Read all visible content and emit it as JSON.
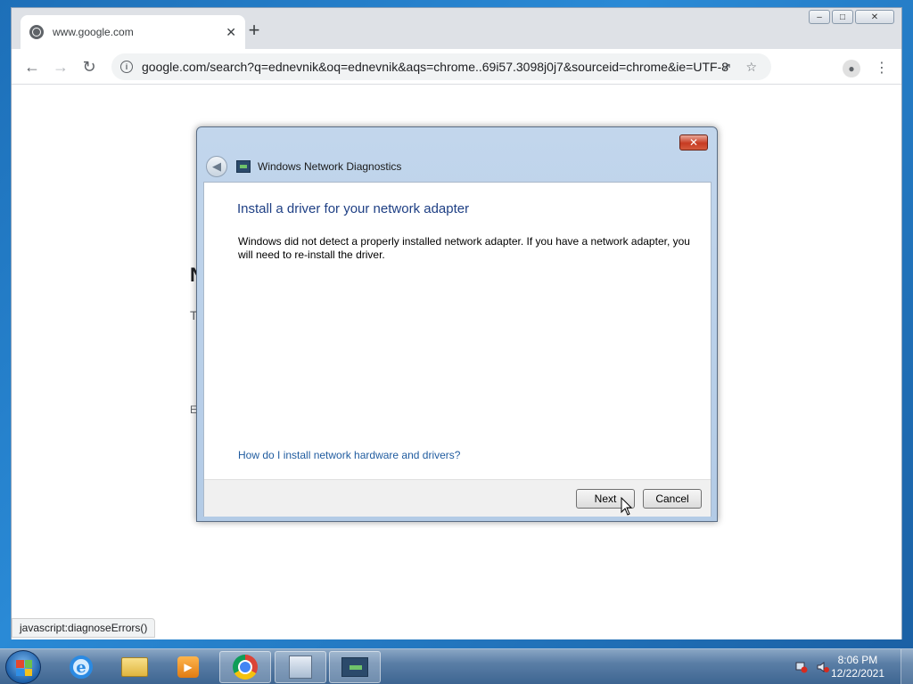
{
  "browser": {
    "tab_title": "www.google.com",
    "tab_close": "✕",
    "new_tab": "+",
    "url": "google.com/search?q=ednevnik&oq=ednevnik&aqs=chrome..69i57.3098j0j7&sourceid=chrome&ie=UTF-8",
    "status_text": "javascript:diagnoseErrors()",
    "page_fragments": [
      "N",
      "T",
      "E"
    ]
  },
  "dialog": {
    "title": "Windows Network Diagnostics",
    "heading": "Install a driver for your network adapter",
    "body": "Windows did not detect a properly installed network adapter. If you have a network adapter, you will need to re-install the driver.",
    "link": "How do I install network hardware and drivers?",
    "next_label": "Next",
    "cancel_label": "Cancel"
  },
  "taskbar": {
    "time": "8:06 PM",
    "date": "12/22/2021",
    "items": [
      "internet-explorer",
      "windows-explorer",
      "windows-media-player",
      "google-chrome",
      "network-diagnostics",
      "network-diagnostics-window"
    ]
  },
  "colors": {
    "dialog_heading": "#1e3f84",
    "link": "#1f5b9f",
    "taskbar": "#3e6591"
  }
}
